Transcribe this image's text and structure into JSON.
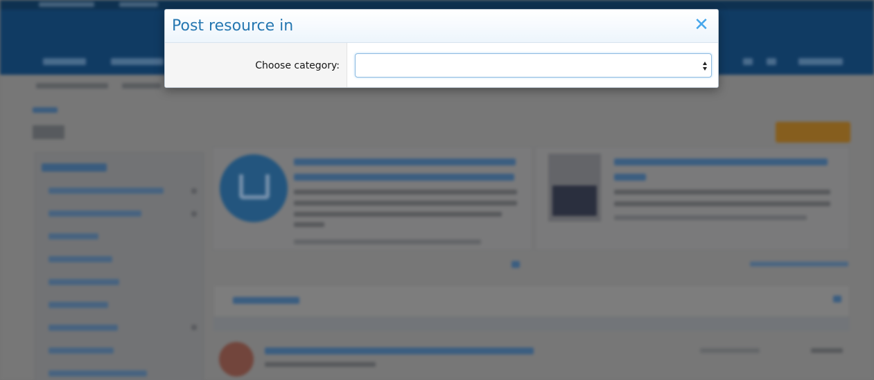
{
  "modal": {
    "title": "Post resource in",
    "close_icon": "close-icon"
  },
  "form": {
    "category_label": "Choose category:",
    "category_value": ""
  },
  "colors": {
    "title": "#2577b1",
    "close": "#47a7eb",
    "select_border": "#8fbbe0"
  }
}
